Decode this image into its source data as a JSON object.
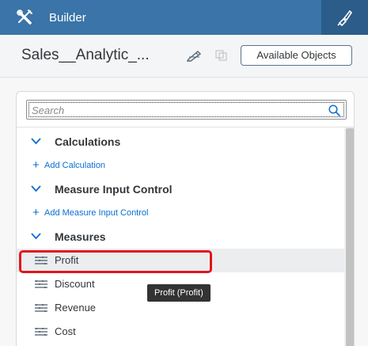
{
  "header": {
    "title": "Builder"
  },
  "toolbar": {
    "model_name": "Sales__Analytic_...",
    "available_objects_label": "Available Objects"
  },
  "search": {
    "placeholder": "Search"
  },
  "groups": {
    "calculations": {
      "label": "Calculations",
      "add_label": "Add Calculation"
    },
    "measure_input_control": {
      "label": "Measure Input Control",
      "add_label": "Add Measure Input Control"
    },
    "measures": {
      "label": "Measures",
      "items": [
        "Profit",
        "Discount",
        "Revenue",
        "Cost"
      ]
    }
  },
  "tooltip": {
    "text": "Profit (Profit)"
  },
  "colors": {
    "header_bg": "#3a74a8",
    "link": "#0a6ed1",
    "highlight": "#e5141b"
  }
}
